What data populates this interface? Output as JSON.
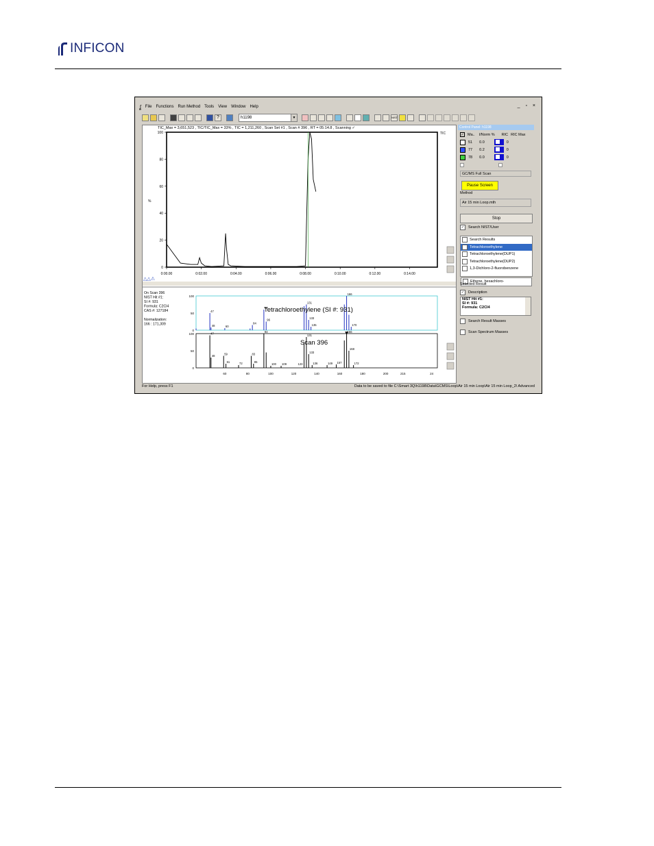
{
  "header": {
    "brand": "INFICON"
  },
  "app": {
    "menu": [
      "File",
      "Functions",
      "Run Method",
      "Tools",
      "View",
      "Window",
      "Help"
    ],
    "window_controls": "_ ▫ ×",
    "instrument_combo": "h1198",
    "tic_title": "TIC_Max = 3,651,523 , TIC/TIC_Max = 33% , TIC = 1,211,260 , Scan Set #1 , Scan #   396 , RT = 05:14.8 , Scanning ✓",
    "tic_side_label": "TIC",
    "status_left": "For Help, press F1",
    "status_right": "Data to be saved to file C:\\Smart 3Q\\h1198\\Data\\GCMS\\Loop\\Air 15 min Loop\\Air 15 min Loop_2\\ Advanced"
  },
  "spectrum_info": {
    "lines": [
      "On Scan 396",
      "NIST Hit #1:",
      "SI #: 931",
      "Formula: C2Cl4",
      "CAS #: 127184",
      "",
      "Normalization:",
      "  166 : 171,309"
    ],
    "top_label": "Tetrachloroethylene (SI #: 931)",
    "bottom_label": "Scan 396"
  },
  "panel": {
    "title": "Control Panel: h1198",
    "headers": [
      "Ma..",
      "I/Norm %",
      "RIC",
      "RIC Max"
    ],
    "rows": [
      {
        "mass": "51",
        "norm": "0.0",
        "ricmax": "0",
        "color": "#ffffff"
      },
      {
        "mass": "77",
        "norm": "0.2",
        "ricmax": "0",
        "color": "#3050ff"
      },
      {
        "mass": "78",
        "norm": "0.0",
        "ricmax": "0",
        "color": "#40d040"
      }
    ],
    "scan_mode": "GC/MS Full Scan",
    "pause_label": "Pause Screen",
    "method_label": "Method",
    "method_value": "Air 15 min Loop.mth",
    "stop_label": "Stop",
    "search_nist": "Search NIST/User",
    "search_results_label": "Search Results",
    "results": [
      "Tetrachloroethylene",
      "Tetrachloroethylene(DUP1)",
      "Tetrachloroethylene(DUP2)",
      "1,3-Dichloro-2-fluorobenzene",
      "Ethene, hexachloro-"
    ],
    "selected_result_label": "Selected Result",
    "description_label": "Description",
    "description_lines": [
      "NIST Hit #1:",
      "SI #: 931",
      "Formula: C2Cl4"
    ],
    "search_result_masses": "Search Result Masses",
    "scan_spectrum_masses": "Scan Spectrum Masses"
  },
  "chart_data": [
    {
      "type": "line",
      "title": "",
      "ylabel": "%",
      "xlabel": "",
      "ylim": [
        0,
        100
      ],
      "yticks": [
        0,
        20,
        40,
        60,
        80,
        100
      ],
      "xtick_labels": [
        "0:00.00",
        "0:02.00",
        "0:04.00",
        "0:06.00",
        "0:08.00",
        "0:10.00",
        "0:12.00",
        "0:14.00"
      ],
      "xlim_min": [
        0,
        15.6
      ],
      "series": [
        {
          "x": [
            0,
            0.8,
            1.4,
            1.8,
            1.9,
            2.0,
            2.2,
            2.6,
            3.3,
            3.4,
            3.45,
            3.55,
            3.7,
            4.5,
            6.0,
            7.5,
            8.0,
            8.15,
            8.25,
            8.35,
            8.45,
            8.6
          ],
          "y": [
            17,
            3,
            2,
            2,
            7,
            3,
            1,
            0.5,
            1,
            25,
            14,
            2,
            1,
            0.5,
            0.5,
            0.5,
            1,
            80,
            100,
            95,
            65,
            56
          ]
        }
      ]
    },
    {
      "type": "bar",
      "title": "Tetrachloroethylene (SI #: 931)",
      "ylim": [
        0,
        100
      ],
      "yticks": [
        0,
        50,
        100
      ],
      "xlim": [
        35,
        245
      ],
      "peaks": [
        {
          "x": 35,
          "y": 5
        },
        {
          "x": 47,
          "y": 50
        },
        {
          "x": 48,
          "y": 8
        },
        {
          "x": 60,
          "y": 6
        },
        {
          "x": 82,
          "y": 5
        },
        {
          "x": 84,
          "y": 15
        },
        {
          "x": 94,
          "y": 60
        },
        {
          "x": 96,
          "y": 25
        },
        {
          "x": 129,
          "y": 70
        },
        {
          "x": 131,
          "y": 75
        },
        {
          "x": 133,
          "y": 30
        },
        {
          "x": 135,
          "y": 10
        },
        {
          "x": 164,
          "y": 75
        },
        {
          "x": 166,
          "y": 100
        },
        {
          "x": 168,
          "y": 45
        },
        {
          "x": 170,
          "y": 10
        }
      ],
      "peak_labels": [
        "47",
        "48",
        "60",
        "84",
        "94",
        "96",
        "131",
        "133",
        "135",
        "166",
        "170"
      ]
    },
    {
      "type": "bar",
      "title": "Scan 396",
      "ylim": [
        0,
        100
      ],
      "yticks": [
        0,
        50,
        100
      ],
      "xlim": [
        35,
        245
      ],
      "xtick_labels": [
        "60",
        "80",
        "100",
        "120",
        "140",
        "160",
        "180",
        "200",
        "215",
        "24"
      ],
      "xticks": [
        60,
        80,
        100,
        120,
        140,
        160,
        180,
        200,
        215,
        240
      ],
      "peaks": [
        {
          "x": 47,
          "y": 95
        },
        {
          "x": 48,
          "y": 30
        },
        {
          "x": 59,
          "y": 35
        },
        {
          "x": 61,
          "y": 12
        },
        {
          "x": 72,
          "y": 8
        },
        {
          "x": 83,
          "y": 35
        },
        {
          "x": 85,
          "y": 12
        },
        {
          "x": 94,
          "y": 100
        },
        {
          "x": 96,
          "y": 45
        },
        {
          "x": 100,
          "y": 6
        },
        {
          "x": 109,
          "y": 6
        },
        {
          "x": 129,
          "y": 75
        },
        {
          "x": 131,
          "y": 90
        },
        {
          "x": 133,
          "y": 40
        },
        {
          "x": 136,
          "y": 8
        },
        {
          "x": 149,
          "y": 8
        },
        {
          "x": 157,
          "y": 10
        },
        {
          "x": 164,
          "y": 80
        },
        {
          "x": 166,
          "y": 100
        },
        {
          "x": 168,
          "y": 50
        },
        {
          "x": 172,
          "y": 8
        }
      ],
      "peak_labels": [
        "47",
        "48",
        "59",
        "61",
        "72",
        "83",
        "85",
        "94",
        "100",
        "109",
        "123",
        "131",
        "133",
        "136",
        "149",
        "157",
        "166",
        "168",
        "172"
      ]
    }
  ]
}
